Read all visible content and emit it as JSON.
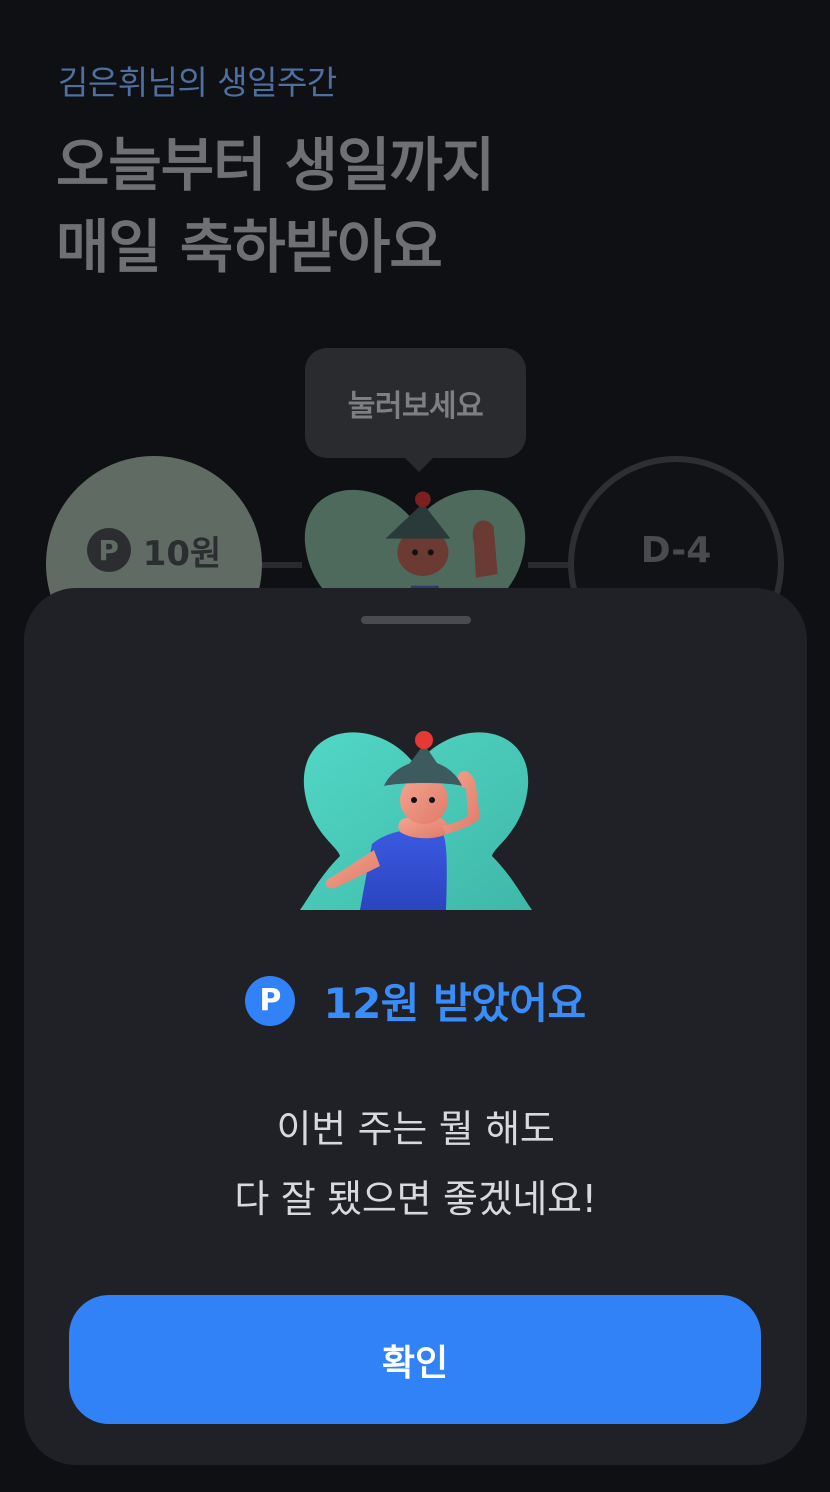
{
  "header": {
    "subtitle": "김은휘님의 생일주간",
    "headline_line1": "오늘부터 생일까지",
    "headline_line2": "매일 축하받아요"
  },
  "tooltip": {
    "text": "눌러보세요"
  },
  "days": [
    {
      "state": "claimed",
      "badge": "P",
      "amount": "10원"
    },
    {
      "state": "today",
      "icon": "birthday-character-icon"
    },
    {
      "state": "upcoming",
      "label": "D-4"
    }
  ],
  "sheet": {
    "illustration_icon": "birthday-character-icon",
    "reward_badge": "P",
    "reward_text": "12원 받았어요",
    "message_line1": "이번 주는 뭘 해도",
    "message_line2": "다 잘 됐으면 좋겠네요!",
    "confirm_label": "확인"
  },
  "colors": {
    "accent": "#3182f6",
    "sheet_background": "#202126",
    "illustration_teal": "#4fd1c5"
  }
}
